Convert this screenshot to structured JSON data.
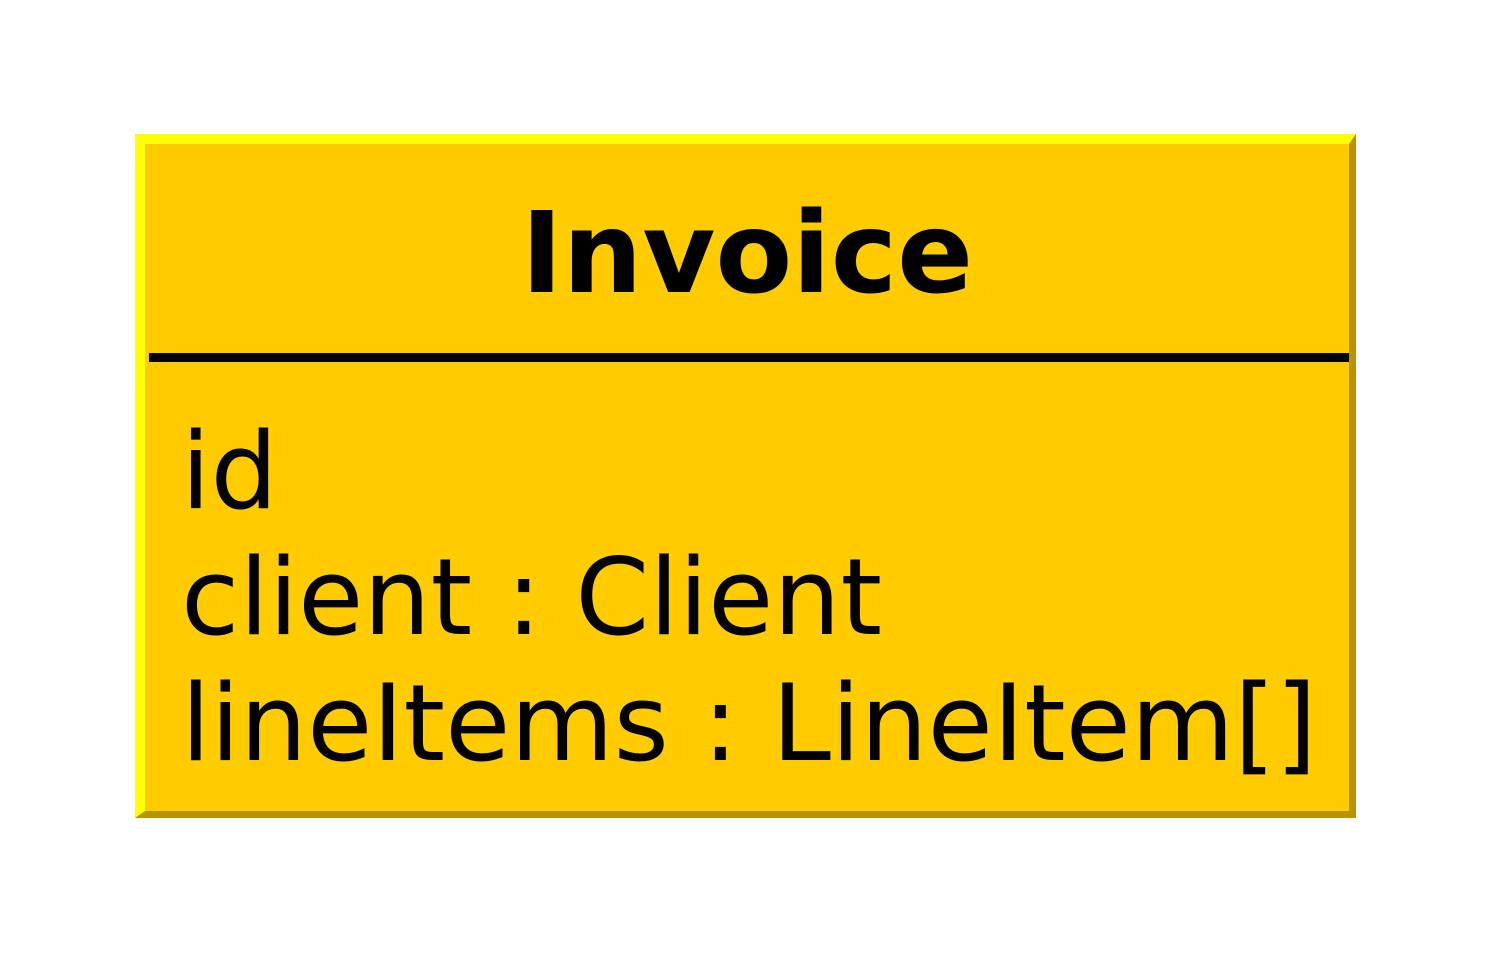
{
  "class_box": {
    "name": "Invoice",
    "attributes": [
      "id",
      "client : Client",
      "lineItems : LineItem[]"
    ]
  },
  "colors": {
    "fill": "#ffcc00",
    "highlight": "#ffff00",
    "shadow": "#b89400",
    "text": "#000000"
  }
}
